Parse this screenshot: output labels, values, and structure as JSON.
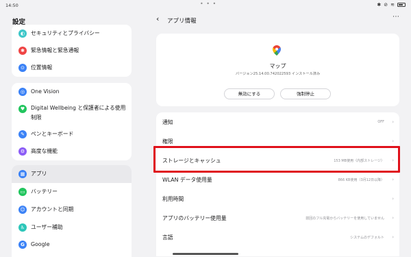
{
  "status_bar": {
    "time": "14:50",
    "dots": "• • •"
  },
  "left": {
    "title": "設定",
    "group1": [
      {
        "label": "セキュリティとプライバシー",
        "icon": "shield-icon",
        "color": "#3ec7c9",
        "glyph": "◐"
      },
      {
        "label": "緊急情報と緊急通報",
        "icon": "emergency-icon",
        "color": "#ef4444",
        "glyph": "✱"
      },
      {
        "label": "位置情報",
        "icon": "location-icon",
        "color": "#3b82f6",
        "glyph": "⊙"
      }
    ],
    "group2": [
      {
        "label": "One Vision",
        "icon": "vision-icon",
        "color": "#3b82f6",
        "glyph": "◎"
      },
      {
        "label": "Digital Wellbeing と保護者による使用",
        "label2": "制限",
        "icon": "wellbeing-icon",
        "color": "#22c55e",
        "glyph": "♥"
      },
      {
        "label": "ペンとキーボード",
        "icon": "pen-icon",
        "color": "#3b82f6",
        "glyph": "✎"
      },
      {
        "label": "高度な機能",
        "icon": "advanced-icon",
        "color": "#8b5cf6",
        "glyph": "⚙"
      }
    ],
    "group3": [
      {
        "label": "アプリ",
        "icon": "apps-icon",
        "color": "#3b82f6",
        "glyph": "▦"
      },
      {
        "label": "バッテリー",
        "icon": "battery-icon",
        "color": "#22c55e",
        "glyph": "▭"
      },
      {
        "label": "アカウントと同期",
        "icon": "account-icon",
        "color": "#3b82f6",
        "glyph": "☺"
      },
      {
        "label": "ユーザー補助",
        "icon": "accessibility-icon",
        "color": "#2cc6b9",
        "glyph": "♿"
      },
      {
        "label": "Google",
        "icon": "google-icon",
        "color": "#3b82f6",
        "glyph": "G"
      }
    ]
  },
  "right": {
    "title": "アプリ情報",
    "app_name": "マップ",
    "app_version": "バージョン25.14.00.742022593 インストール済み",
    "btn_disable": "無効にする",
    "btn_force_stop": "強制停止",
    "rows": [
      {
        "label": "通知",
        "value": "OFF"
      },
      {
        "label": "権限",
        "value": ""
      },
      {
        "label": "ストレージとキャッシュ",
        "value": "153 MB使用（内部ストレージ）"
      },
      {
        "label": "WLAN データ使用量",
        "value": "866 KB使用（3月12日以降）"
      },
      {
        "label": "利用時間",
        "value": ""
      },
      {
        "label": "アプリのバッテリー使用量",
        "value": "前回のフル充電からバッテリーを使用していません"
      },
      {
        "label": "言語",
        "value": "システムのデフォルト"
      }
    ]
  },
  "colors": {
    "highlight": "#e0111b",
    "selected_bg": "#e9e9ec"
  }
}
